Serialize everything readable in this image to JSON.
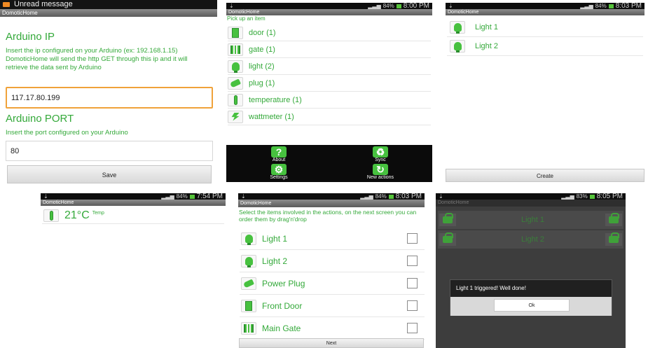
{
  "s1": {
    "status_title": "Unread message",
    "app_title": "DomoticHome",
    "ip_heading": "Arduino IP",
    "ip_desc": "Insert the ip configured on your Arduino (ex: 192.168.1.15) DomoticHome will send the http GET through this ip and it will retrieve the data sent by Arduino",
    "ip_value": "117.17.80.199",
    "port_heading": "Arduino PORT",
    "port_desc": "Insert the port configured on your Arduino",
    "port_value": "80",
    "save_label": "Save"
  },
  "s2": {
    "time": "8:00 PM",
    "battery": "84%",
    "app_title": "DomoticHome",
    "prompt": "Pick up an item",
    "items": [
      {
        "label": "door (1)",
        "icon": "door-icon"
      },
      {
        "label": "gate (1)",
        "icon": "gate-icon"
      },
      {
        "label": "light (2)",
        "icon": "light-bulb-icon"
      },
      {
        "label": "plug (1)",
        "icon": "plug-icon"
      },
      {
        "label": "temperature (1)",
        "icon": "thermometer-icon"
      },
      {
        "label": "wattmeter (1)",
        "icon": "bolt-icon"
      }
    ],
    "menu": {
      "about": "About",
      "sync": "Sync",
      "settings": "Settings",
      "new_actions": "New actions"
    }
  },
  "s3": {
    "time": "8:03 PM",
    "battery": "84%",
    "app_title": "DomoticHome",
    "items": [
      "Light 1",
      "Light 2"
    ],
    "create_label": "Create"
  },
  "s4": {
    "time": "7:54 PM",
    "battery": "84%",
    "app_title": "DomoticHome",
    "temp_value": "21°C",
    "temp_label": "Temp"
  },
  "s5": {
    "time": "8:03 PM",
    "battery": "84%",
    "app_title": "DomoticHome",
    "instructions": "Select the items involved in the actions, on the next screen you can order them by drag'n'drop",
    "items": [
      {
        "label": "Light 1",
        "icon": "light-bulb-icon"
      },
      {
        "label": "Light 2",
        "icon": "light-bulb-icon"
      },
      {
        "label": "Power Plug",
        "icon": "plug-icon"
      },
      {
        "label": "Front Door",
        "icon": "door-icon"
      },
      {
        "label": "Main Gate",
        "icon": "gate-icon"
      }
    ],
    "next_label": "Next"
  },
  "s6": {
    "time": "8:05 PM",
    "battery": "83%",
    "app_title": "DomoticHome",
    "items": [
      "Light 1",
      "Light 2"
    ],
    "dialog_message": "Light 1 triggered! Well done!",
    "ok_label": "Ok"
  },
  "colors": {
    "accent_green": "#34a93a",
    "icon_green": "#47c13f",
    "status_bar": "#0d0d0d",
    "action_bar": "#6e6e6e"
  }
}
